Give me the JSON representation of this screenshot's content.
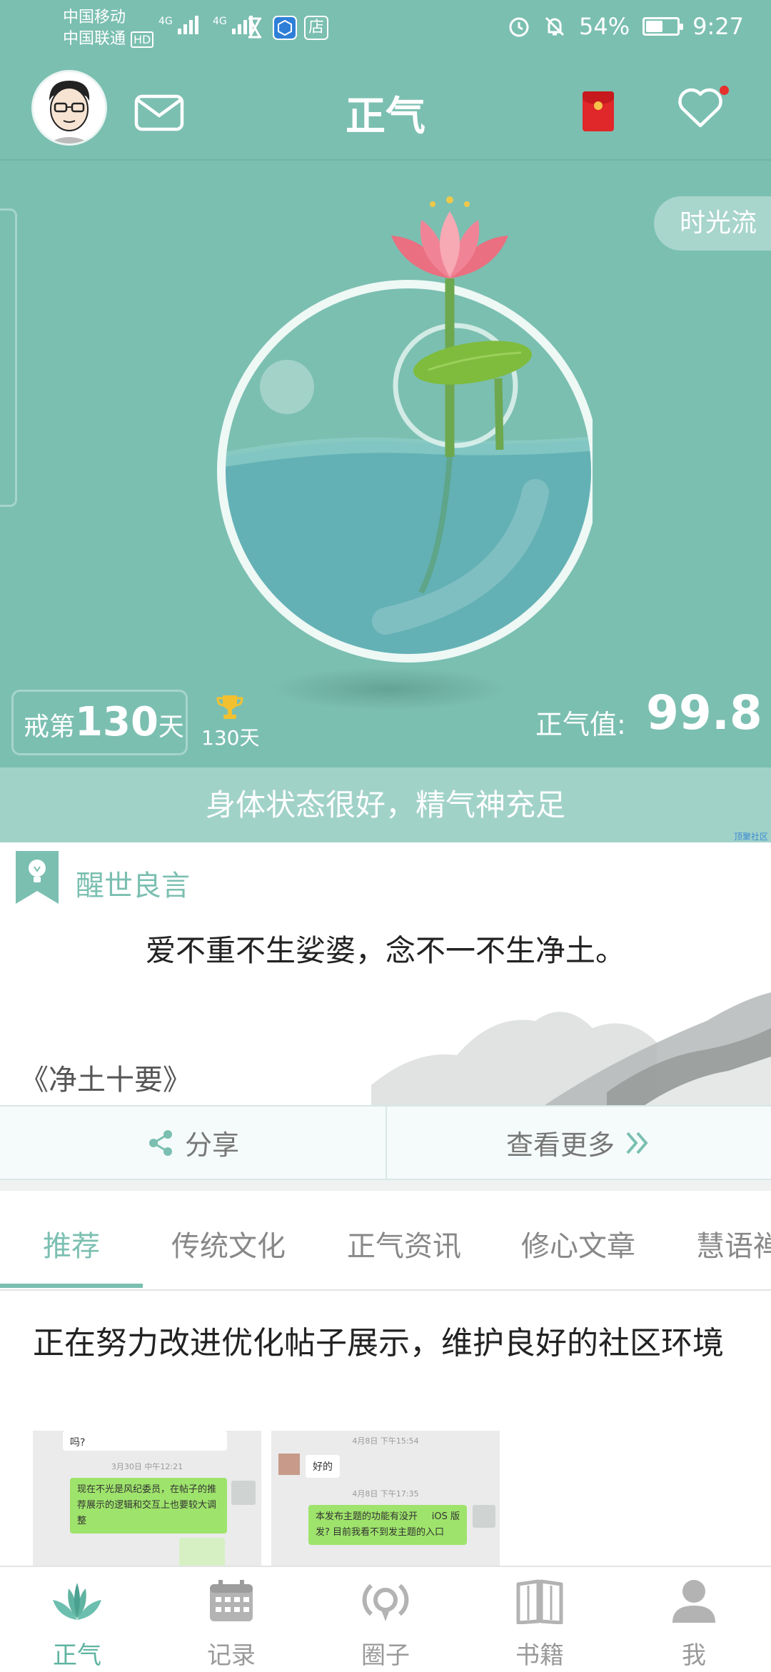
{
  "status": {
    "carrier1": "中国移动",
    "carrier2": "中国联通",
    "hd": "HD",
    "net1": "4G",
    "net2": "4G",
    "store_glyph": "店",
    "battery_text": "54%",
    "battery_level": 0.54,
    "time": "9:27"
  },
  "header": {
    "title": "正气",
    "timeflow": "时光流"
  },
  "stats": {
    "days_prefix": "戒第",
    "days_num": "130",
    "days_suffix": "天",
    "trophy_days": "130天",
    "zq_label": "正气值:",
    "zq_value": "99.8",
    "state_text": "身体状态很好，精气神充足",
    "tiny_text": "顶聚社区"
  },
  "quote": {
    "heading": "醒世良言",
    "text": "爱不重不生娑婆，念不一不生净土。",
    "source": "《净土十要》",
    "share": "分享",
    "more": "查看更多"
  },
  "tabs": [
    {
      "label": "推荐"
    },
    {
      "label": "传统文化"
    },
    {
      "label": "正气资讯"
    },
    {
      "label": "修心文章"
    },
    {
      "label": "慧语禅"
    }
  ],
  "post": {
    "title": "正在努力改进优化帖子展示，维护良好的社区环境",
    "img1": {
      "top_msg": "吗?",
      "time": "3月30日 中午12:21",
      "bubble": "现在不光是风纪委员，在帖子的推荐展示的逻辑和交互上也要较大调整"
    },
    "img2": {
      "time1": "4月8日 下午15:54",
      "reply": "好的",
      "time2": "4月8日 下午17:35",
      "bubble_tag": "iOS 版",
      "bubble": "本发布主题的功能有没开发? 目前我看不到发主题的入口"
    }
  },
  "bottom_nav": [
    {
      "label": "正气",
      "icon": "lotus-icon"
    },
    {
      "label": "记录",
      "icon": "calendar-icon"
    },
    {
      "label": "圈子",
      "icon": "broadcast-icon"
    },
    {
      "label": "书籍",
      "icon": "book-icon"
    },
    {
      "label": "我",
      "icon": "user-icon"
    }
  ],
  "colors": {
    "accent": "#7bbfb1",
    "active_nav": "#5fb3a1",
    "red": "#e0272a"
  }
}
